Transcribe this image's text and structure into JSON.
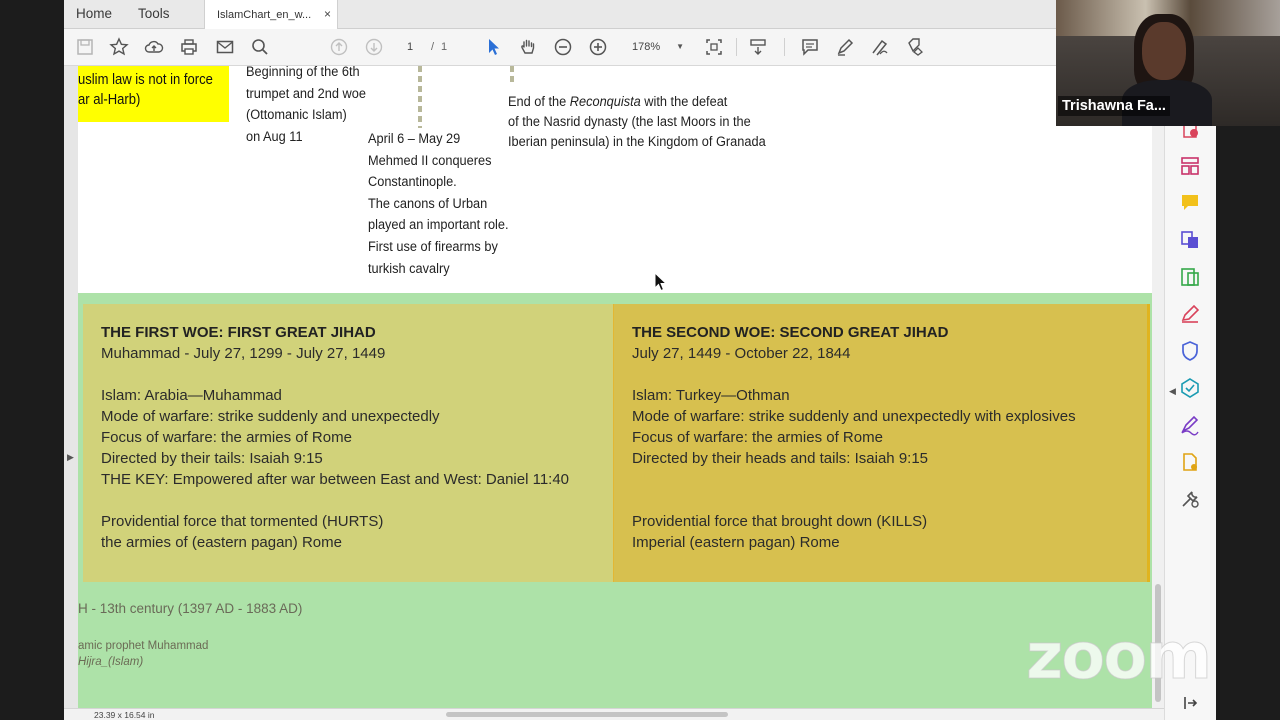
{
  "tabs": {
    "home": "Home",
    "tools": "Tools",
    "doc_tab": "IslamChart_en_w...",
    "close": "×"
  },
  "toolbar": {
    "page_current": "1",
    "page_sep": "/",
    "page_total": "1",
    "zoom": "178%"
  },
  "document": {
    "yellow_box": [
      "uslim law is not in force",
      "ar al-Harb)"
    ],
    "sixth_trumpet": [
      "Beginning of the 6th",
      "trumpet and 2nd woe",
      "(Ottomanic Islam)",
      "on Aug 11"
    ],
    "constantinople": [
      "April 6 – May 29",
      "Mehmed II conqueres",
      "Constantinople.",
      "The canons of Urban",
      "played an important role.",
      "First use of firearms by",
      "turkish cavalry"
    ],
    "reconquista": {
      "line1_pre": "End of the ",
      "line1_em": "Reconquista",
      "line1_post": " with the defeat",
      "line2": "of the Nasrid dynasty (the last Moors in the",
      "line3": "Iberian peninsula) in the Kingdom of Granada"
    },
    "woe1": [
      "THE FIRST WOE: FIRST GREAT JIHAD",
      "Muhammad - July 27, 1299 - July 27, 1449",
      "",
      "Islam: Arabia—Muhammad",
      "Mode of warfare: strike suddenly and unexpectedly",
      "Focus of warfare: the armies of Rome",
      "Directed by their tails: Isaiah 9:15",
      "THE KEY: Empowered after war between East and West: Daniel 11:40",
      "",
      "Providential force that tormented (HURTS)",
      "the armies of (eastern pagan) Rome"
    ],
    "woe2": [
      "THE SECOND WOE: SECOND GREAT JIHAD",
      "July 27, 1449 - October 22, 1844",
      "",
      "Islam: Turkey—Othman",
      "Mode of warfare: strike suddenly and unexpectedly with explosives",
      "Focus of warfare: the armies of Rome",
      "Directed by their heads and tails: Isaiah 9:15",
      "",
      "",
      "Providential force that brought down (KILLS)",
      "Imperial (eastern pagan) Rome"
    ],
    "century_range": "H - 13th century  (1397 AD - 1883 AD)",
    "prophet": "amic prophet Muhammad",
    "hijra": "Hijra_(Islam)"
  },
  "status": {
    "dimensions": "23.39 x 16.54 in"
  },
  "video": {
    "name": "Trishawna Fa..."
  },
  "watermark": "zoom",
  "colors": {
    "woe1": "#d1d27a",
    "woe2": "#d7c04f",
    "band": "#ade2a8",
    "highlight": "#ffff00"
  }
}
